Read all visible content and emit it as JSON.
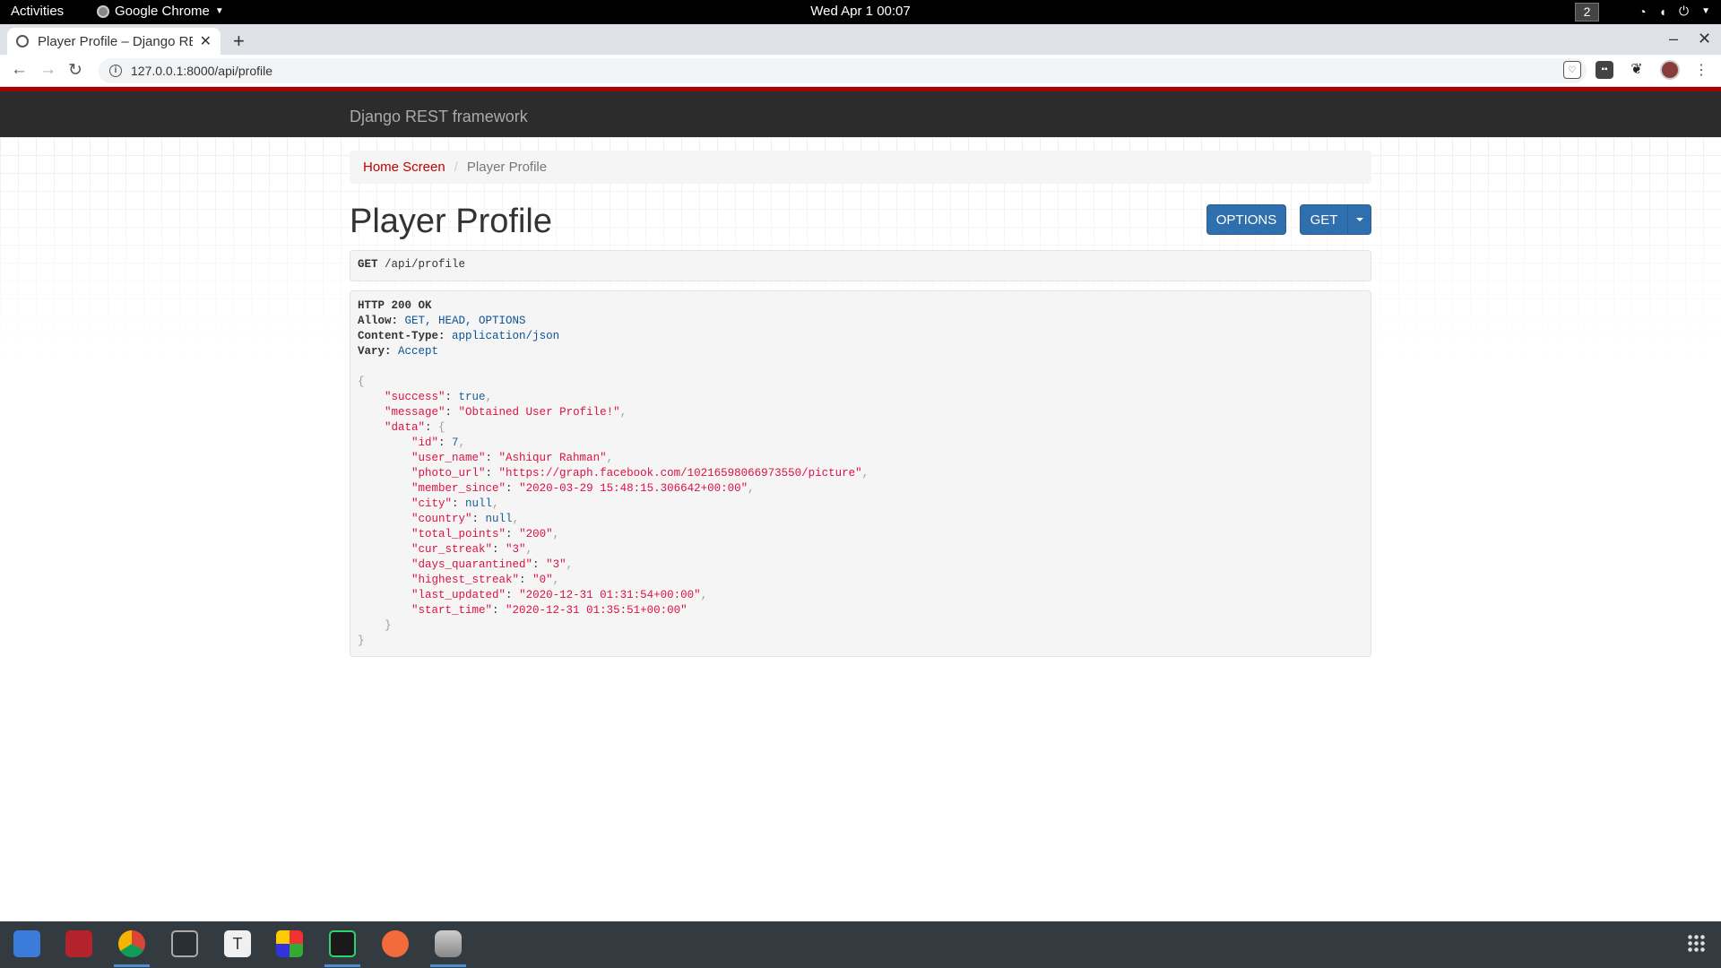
{
  "topbar": {
    "activities": "Activities",
    "app_name": "Google Chrome",
    "clock": "Wed Apr 1  00:07",
    "workspace": "2"
  },
  "browser": {
    "tab_title": "Player Profile – Django RE",
    "url": "127.0.0.1:8000/api/profile"
  },
  "drf": {
    "brand": "Django REST framework",
    "breadcrumb_home": "Home Screen",
    "breadcrumb_sep": "/",
    "breadcrumb_current": "Player Profile",
    "page_title": "Player Profile",
    "options_label": "OPTIONS",
    "get_label": "GET",
    "request_method": "GET",
    "request_path": "/api/profile"
  },
  "response": {
    "status": "HTTP 200 OK",
    "headers": [
      {
        "name": "Allow:",
        "value": "GET, HEAD, OPTIONS"
      },
      {
        "name": "Content-Type:",
        "value": "application/json"
      },
      {
        "name": "Vary:",
        "value": "Accept"
      }
    ],
    "body": {
      "success": "true",
      "message": "\"Obtained User Profile!\"",
      "data": {
        "id": "7",
        "user_name": "\"Ashiqur Rahman\"",
        "photo_url": "\"https://graph.facebook.com/10216598066973550/picture\"",
        "member_since": "\"2020-03-29 15:48:15.306642+00:00\"",
        "city": "null",
        "country": "null",
        "total_points": "\"200\"",
        "cur_streak": "\"3\"",
        "days_quarantined": "\"3\"",
        "highest_streak": "\"0\"",
        "last_updated": "\"2020-12-31 01:31:54+00:00\"",
        "start_time": "\"2020-12-31 01:35:51+00:00\""
      }
    }
  },
  "taskbar": {
    "apps": [
      "files-icon",
      "terminal-icon",
      "chrome-icon",
      "system-monitor-icon",
      "text-editor-icon",
      "office-icon",
      "pycharm-icon",
      "postman-icon",
      "database-icon"
    ]
  }
}
